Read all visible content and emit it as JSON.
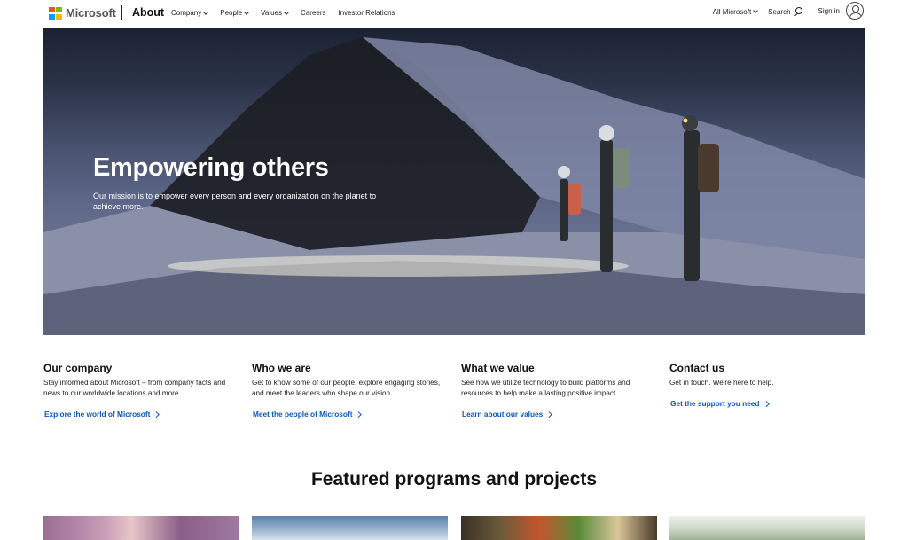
{
  "header": {
    "logo_text": "Microsoft",
    "section_title": "About",
    "nav": [
      {
        "label": "Company",
        "dropdown": true
      },
      {
        "label": "People",
        "dropdown": true
      },
      {
        "label": "Values",
        "dropdown": true
      },
      {
        "label": "Careers",
        "dropdown": false
      },
      {
        "label": "Investor Relations",
        "dropdown": false
      }
    ],
    "all_microsoft": "All Microsoft",
    "search": "Search",
    "sign_in": "Sign in"
  },
  "hero": {
    "title": "Empowering others",
    "subtitle": "Our mission is to empower every person and every organization on the planet to achieve more."
  },
  "columns": [
    {
      "title": "Our company",
      "text": "Stay informed about Microsoft – from company facts and news to our worldwide locations and more.",
      "link": "Explore the world of Microsoft"
    },
    {
      "title": "Who we are",
      "text": "Get to know some of our people, explore engaging stories, and meet the leaders who shape our vision.",
      "link": "Meet the people of Microsoft"
    },
    {
      "title": "What we value",
      "text": "See how we utilize technology to build platforms and resources to help make a lasting positive impact.",
      "link": "Learn about our values"
    },
    {
      "title": "Contact us",
      "text": "Get in touch. We're here to help.",
      "link": "Get the support you need"
    }
  ],
  "featured_heading": "Featured programs and projects",
  "colors": {
    "link": "#0b58b5",
    "logo_red": "#f25022",
    "logo_green": "#7fba00",
    "logo_blue": "#00a4ef",
    "logo_yellow": "#ffb900"
  }
}
